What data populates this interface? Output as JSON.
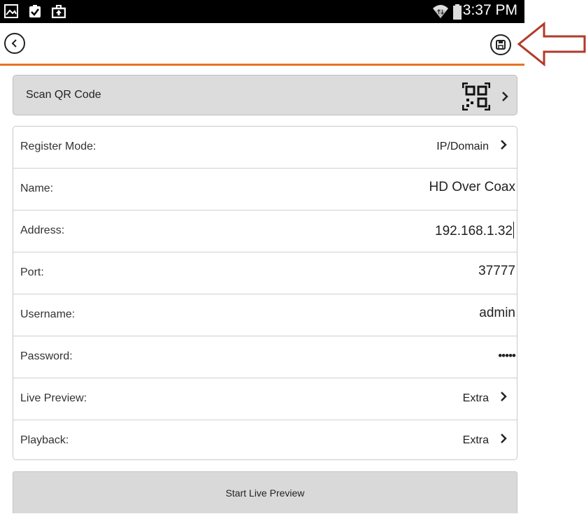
{
  "status_bar": {
    "time": "3:37 PM",
    "icons": [
      "gallery-icon",
      "clipboard-check-icon",
      "briefcase-upload-icon",
      "wifi-icon",
      "battery-icon"
    ]
  },
  "action_bar": {
    "back_icon": "back-arrow-icon",
    "save_icon": "save-icon",
    "accent_color": "#e8731f",
    "annotation_arrow_color": "#b23a2a"
  },
  "qr": {
    "label": "Scan QR Code",
    "icon": "qr-code-icon"
  },
  "form": {
    "rows": [
      {
        "label": "Register Mode:",
        "value": "IP/Domain"
      },
      {
        "label": "Name:",
        "value": "HD Over Coax"
      },
      {
        "label": "Address:",
        "value": "192.168.1.32"
      },
      {
        "label": "Port:",
        "value": "37777"
      },
      {
        "label": "Username:",
        "value": "admin"
      },
      {
        "label": "Password:",
        "value": "•••••"
      },
      {
        "label": "Live Preview:",
        "value": "Extra"
      },
      {
        "label": "Playback:",
        "value": "Extra"
      }
    ]
  },
  "start_button": {
    "label": "Start Live Preview"
  }
}
